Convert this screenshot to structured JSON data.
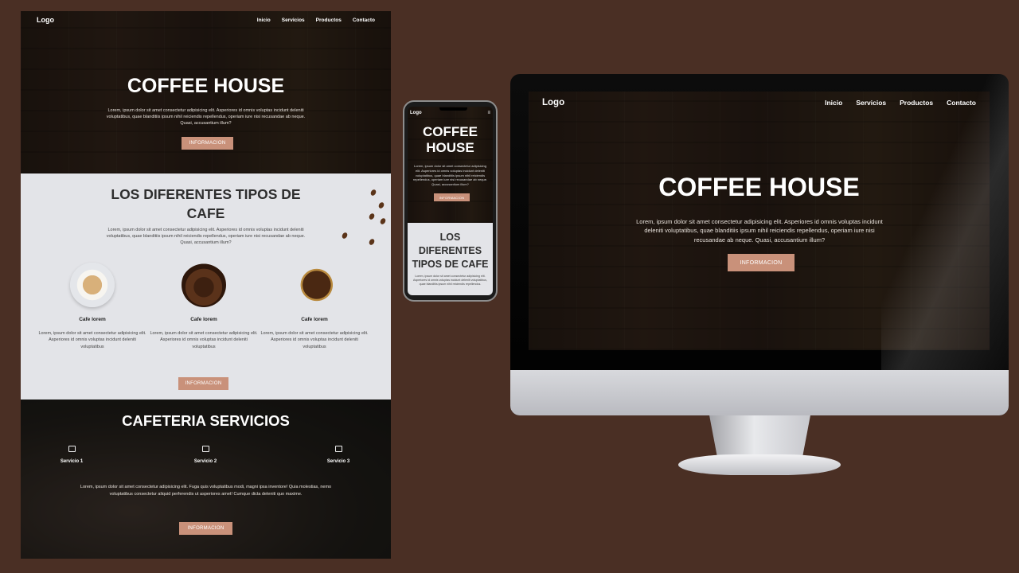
{
  "left": {
    "nav": {
      "logo": "Logo",
      "items": [
        "Inicio",
        "Servicios",
        "Productos",
        "Contacto"
      ]
    },
    "hero": {
      "title": "COFFEE HOUSE",
      "text": "Lorem, ipsum dolor sit amet consectetur adipisicing elit. Asperiores id omnis voluptas incidunt deleniti voluptatibus, quae blanditiis ipsum nihil reiciendis repellendus, operiam iure nisi recusandae ab neque. Quasi, accusantium illum?",
      "button": "INFORMACION"
    },
    "types": {
      "title": "LOS DIFERENTES TIPOS DE CAFE",
      "text": "Lorem, ipsum dolor sit amet consectetur adipisicing elit. Asperiores id omnis voluptas incidunt deleniti voluptatibus, quae blanditiis ipsum nihil reiciendis repellendus, operiam iure nisi recusandae ab neque. Quasi, accusantium illum?",
      "cards": [
        {
          "name": "Cafe lorem",
          "desc": "Lorem, ipsum dolor sit amet consectetur adipisicing elit. Asperiores id omnis voluptas incidunt deleniti voluptatibus"
        },
        {
          "name": "Cafe lorem",
          "desc": "Lorem, ipsum dolor sit amet consectetur adipisicing elit. Asperiores id omnis voluptas incidunt deleniti voluptatibus"
        },
        {
          "name": "Cafe lorem",
          "desc": "Lorem, ipsum dolor sit amet consectetur adipisicing elit. Asperiores id omnis voluptas incidunt deleniti voluptatibus"
        }
      ],
      "button": "INFORMACION"
    },
    "services": {
      "title": "CAFETERIA SERVICIOS",
      "items": [
        "Servicio 1",
        "Servicio 2",
        "Servicio 3"
      ],
      "text": "Lorem, ipsum dolor sit amet consectetur adipisicing elit. Fuga quis voluptatibus modi, magni ipsa inventore! Quia molestias, nemo voluptatibus consectetur aliquid perferendis ut asperiores amet! Cumque dicta deleniti quo maxime.",
      "button": "INFORMACION"
    }
  },
  "phone": {
    "logo": "Logo",
    "menu_icon": "≡",
    "hero": {
      "title": "COFFEE HOUSE",
      "text": "Lorem, ipsum dolor sit amet consectetur adipisicing elit. Asperiores id omnis voluptas incidunt deleniti voluptatibus, quae blanditiis ipsum nihil reiciendis repellendus, operiam iure nisi recusandae ab neque. Quasi, accusantium illum?",
      "button": "INFORMACION"
    },
    "types": {
      "title": "LOS DIFERENTES TIPOS DE CAFE",
      "text": "Lorem, ipsum dolor sit amet consectetur adipisicing elit. Asperiores id omnis voluptas incidunt deleniti voluptatibus, quae blanditiis ipsum nihil reiciendis repellendus."
    }
  },
  "monitor": {
    "nav": {
      "logo": "Logo",
      "items": [
        "Inicio",
        "Servicios",
        "Productos",
        "Contacto"
      ]
    },
    "hero": {
      "title": "COFFEE HOUSE",
      "text": "Lorem, ipsum dolor sit amet consectetur adipisicing elit. Asperiores id omnis voluptas incidunt deleniti voluptatibus, quae blanditiis ipsum nihil reiciendis repellendus, operiam iure nisi recusandae ab neque. Quasi, accusantium illum?",
      "button": "INFORMACION"
    }
  },
  "colors": {
    "background": "#4a2f24",
    "accent": "#c9917a",
    "section_light": "#e3e4e8",
    "text_dark": "#2e2e2e"
  },
  "icons": {
    "service": [
      "coffee-cup-icon",
      "coffee-machine-icon",
      "coffee-mug-icon"
    ]
  }
}
